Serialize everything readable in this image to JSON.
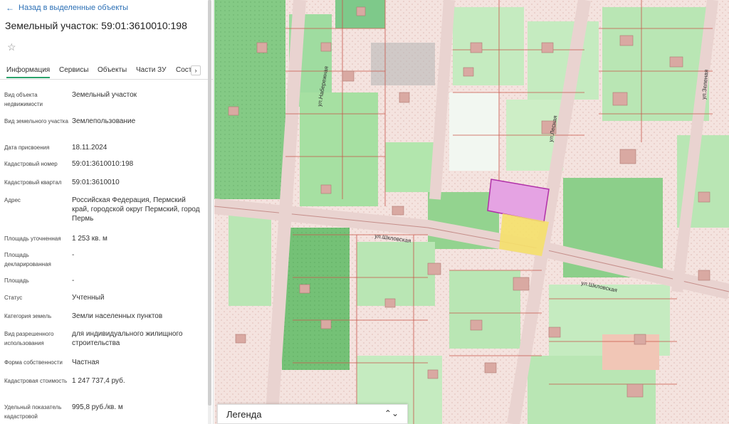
{
  "back_link": "Назад в выделенные объекты",
  "object_title": "Земельный участок: 59:01:3610010:198",
  "tabs": [
    "Информация",
    "Сервисы",
    "Объекты",
    "Части ЗУ",
    "Сост"
  ],
  "fields": [
    {
      "label": "Вид объекта недвижимости",
      "value": "Земельный участок"
    },
    {
      "label": "Вид земельного участка",
      "value": "Землепользование"
    },
    {
      "label": "Дата присвоения",
      "value": "18.11.2024"
    },
    {
      "label": "Кадастровый номер",
      "value": "59:01:3610010:198"
    },
    {
      "label": "Кадастровый квартал",
      "value": "59:01:3610010"
    },
    {
      "label": "Адрес",
      "value": "Российская Федерация, Пермский край, городской округ Пермский, город Пермь"
    },
    {
      "label": "Площадь уточненная",
      "value": "1 253 кв. м"
    },
    {
      "label": "Площадь декларированная",
      "value": "-"
    },
    {
      "label": "Площадь",
      "value": "-"
    },
    {
      "label": "Статус",
      "value": "Учтенный"
    },
    {
      "label": "Категория земель",
      "value": "Земли населенных пунктов"
    },
    {
      "label": "Вид разрешенного использования",
      "value": "для индивидуального жилищного строительства"
    },
    {
      "label": "Форма собственности",
      "value": "Частная"
    },
    {
      "label": "Кадастровая стоимость",
      "value": "1 247 737,4 руб."
    },
    {
      "label": "Удельный показатель кадастровой",
      "value": "995,8 руб./кв. м"
    }
  ],
  "map": {
    "street_labels": [
      "ул.Шкловская",
      "ул.Шкловская",
      "ул.Набережная",
      "ул.Лесная",
      "ул.Зеленая"
    ]
  },
  "legend_label": "Легенда",
  "colors": {
    "accent": "#2aa36b",
    "link": "#2b6fb5",
    "selected_parcel": "#cc44cc",
    "yellow_parcel": "#f5e06a"
  }
}
